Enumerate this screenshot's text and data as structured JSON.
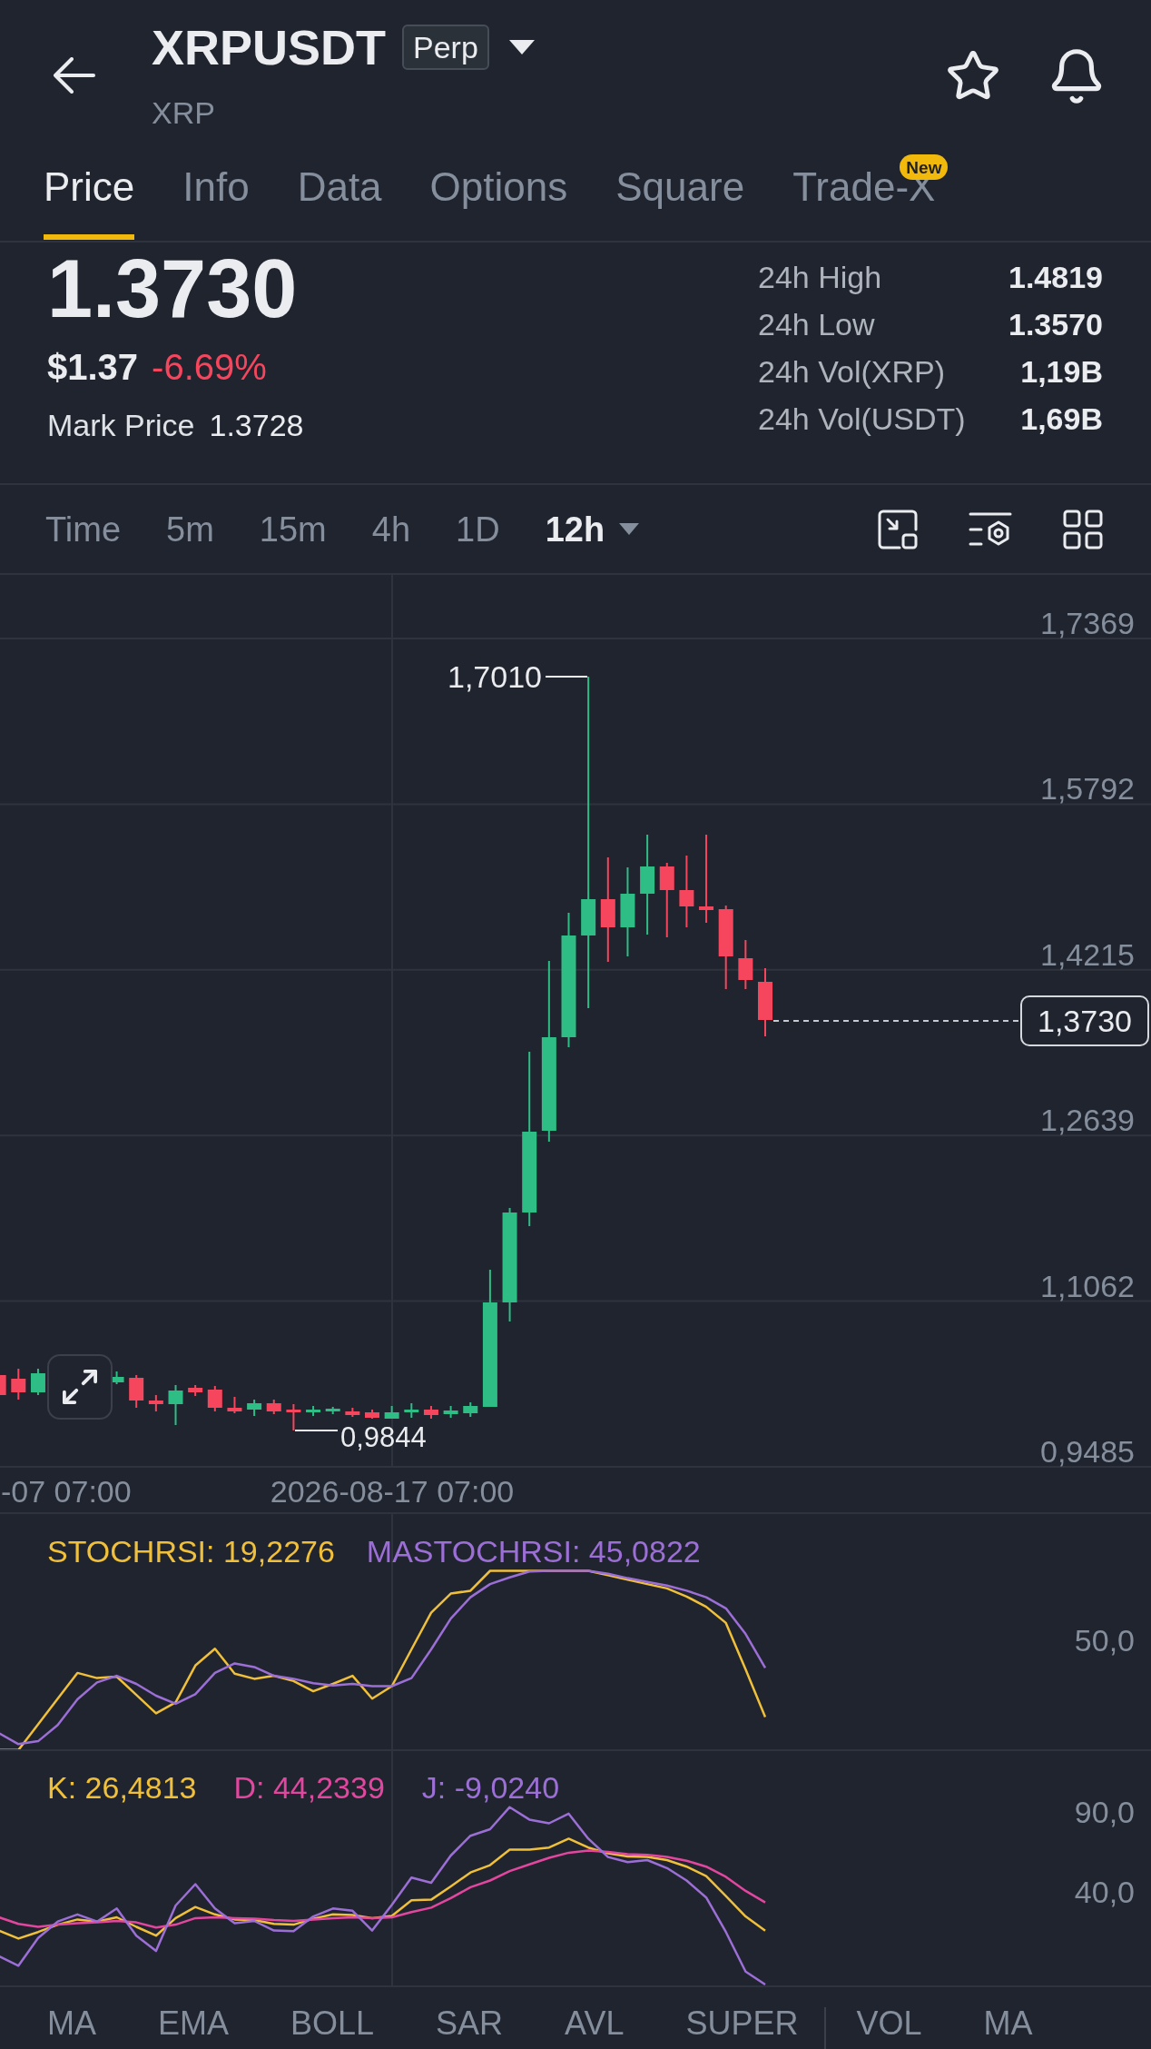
{
  "header": {
    "title": "XRPUSDT",
    "badge": "Perp",
    "subtitle": "XRP"
  },
  "tabs": [
    {
      "label": "Price",
      "selected": true
    },
    {
      "label": "Info",
      "selected": false
    },
    {
      "label": "Data",
      "selected": false
    },
    {
      "label": "Options",
      "selected": false
    },
    {
      "label": "Square",
      "selected": false
    },
    {
      "label": "Trade-X",
      "selected": false,
      "badge": "New"
    }
  ],
  "ticker": {
    "last_price": "1.3730",
    "usd_price": "$1.37",
    "change": "-6.69%",
    "mark_price_label": "Mark Price",
    "mark_price": "1.3728",
    "stats": [
      {
        "label": "24h High",
        "value": "1.4819"
      },
      {
        "label": "24h Low",
        "value": "1.3570"
      },
      {
        "label": "24h Vol(XRP)",
        "value": "1,19B"
      },
      {
        "label": "24h Vol(USDT)",
        "value": "1,69B"
      }
    ]
  },
  "intervals": [
    {
      "label": "Time",
      "selected": false,
      "dropdown": false
    },
    {
      "label": "5m",
      "selected": false,
      "dropdown": false
    },
    {
      "label": "15m",
      "selected": false,
      "dropdown": false
    },
    {
      "label": "4h",
      "selected": false,
      "dropdown": false
    },
    {
      "label": "1D",
      "selected": false,
      "dropdown": false
    },
    {
      "label": "12h",
      "selected": true,
      "dropdown": true
    }
  ],
  "price_chart": {
    "y_labels": [
      "1,7369",
      "1,5792",
      "1,4215",
      "1,2639",
      "1,1062",
      "0,9485"
    ],
    "x_labels": [
      "-07 07:00",
      "2026-08-17 07:00"
    ],
    "high_label": "1,7010",
    "low_label": "0,9844",
    "current_price": "1,3730"
  },
  "stoch_rsi": {
    "legend": [
      {
        "text": "STOCHRSI: 19,2276",
        "color": "#f0c03a"
      },
      {
        "text": "MASTOCHRSI: 45,0822",
        "color": "#9c6fd6"
      }
    ],
    "y_label": "50,0"
  },
  "kdj": {
    "legend": [
      {
        "text": "K: 26,4813",
        "color": "#f0c03a"
      },
      {
        "text": "D: 44,2339",
        "color": "#e2479f"
      },
      {
        "text": "J: -9,0240",
        "color": "#9c6fd6"
      }
    ],
    "y_labels": [
      "90,0",
      "40,0"
    ]
  },
  "indicator_bar": {
    "main": [
      "MA",
      "EMA",
      "BOLL",
      "SAR",
      "AVL",
      "SUPER"
    ],
    "sub": [
      "VOL",
      "MA"
    ]
  }
}
